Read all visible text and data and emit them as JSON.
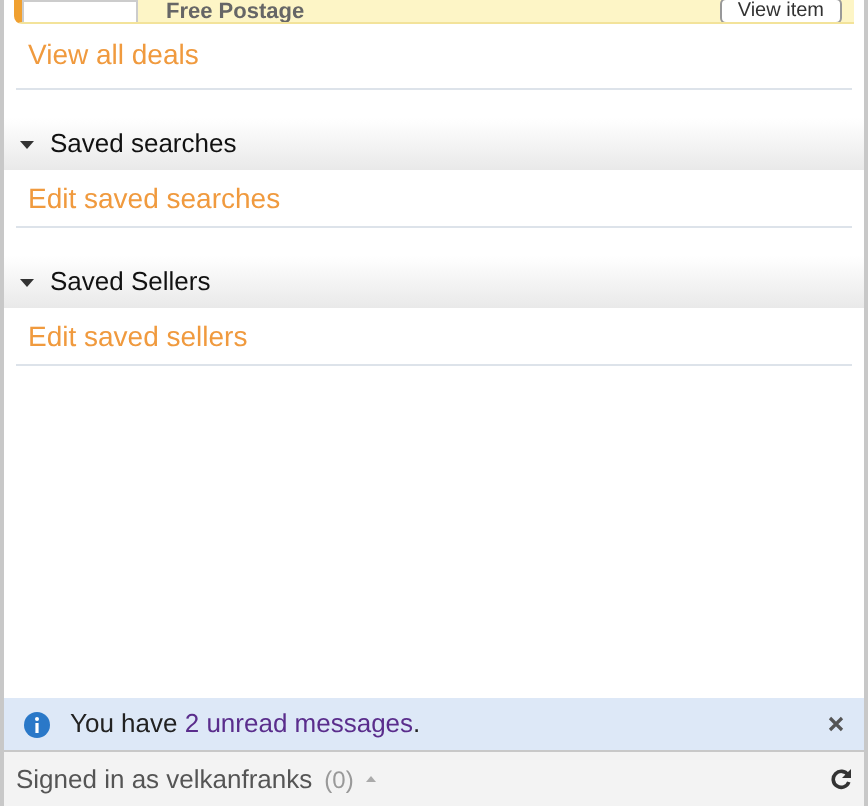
{
  "deal": {
    "shipping": "Free Postage",
    "button": "View item"
  },
  "deals_link": "View all deals",
  "sections": [
    {
      "title": "Saved searches",
      "expanded": true,
      "link": "Edit saved searches"
    },
    {
      "title": "Saved Sellers",
      "expanded": true,
      "link": "Edit saved sellers"
    }
  ],
  "notification": {
    "prefix": "You have ",
    "link": "2 unread messages",
    "suffix": "."
  },
  "status_bar": {
    "signed_in": "Signed in as velkanfranks",
    "count": "(0)"
  }
}
